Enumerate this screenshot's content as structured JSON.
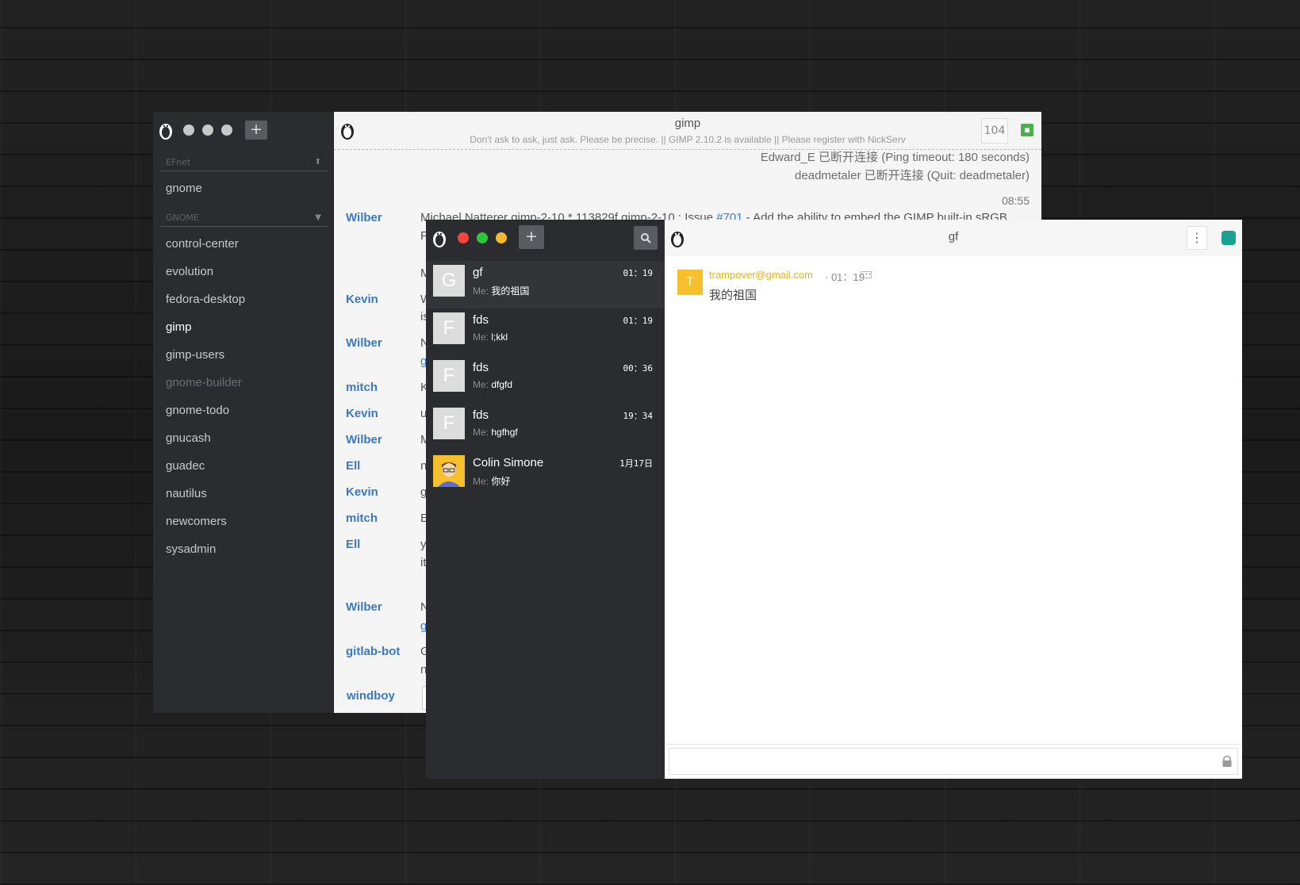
{
  "irc": {
    "networks": [
      {
        "label": "EFnet",
        "channels": [
          "gnome"
        ]
      },
      {
        "label": "GNOME",
        "channels": [
          "control-center",
          "evolution",
          "fedora-desktop",
          "gimp",
          "gimp-users",
          "gnome-builder",
          "gnome-todo",
          "gnucash",
          "guadec",
          "nautilus",
          "newcomers",
          "sysadmin"
        ]
      }
    ],
    "active_channel": "gimp",
    "add_label": "+",
    "title": "gimp",
    "topic": "Don't ask to ask, just ask. Please be precise. || GIMP 2.10.2 is available || Please register with NickServ",
    "user_count": "104",
    "system_messages": [
      "Edward_E 已断开连接 (Ping timeout: 180 seconds)",
      "deadmetaler 已断开连接 (Quit: deadmetaler)"
    ],
    "timestamp": "08:55",
    "first_message": {
      "before": "Michael Natterer gimp-2-10 * 113829f gimp-2-10 : Issue ",
      "link": "#701",
      "after": " - Add the ability to embed the GIMP built-in sRGB"
    },
    "nicks": [
      "Wilber",
      "Kevin",
      "Wilber",
      "mitch",
      "Kevin",
      "Wilber",
      "Ell",
      "Kevin",
      "mitch",
      "Ell",
      "Wilber",
      "gitlab-bot",
      "windboy"
    ],
    "line_fragments": [
      "P",
      "M",
      "W",
      "is",
      "N",
      "g",
      "K",
      "u",
      "M",
      "n",
      "g",
      "E",
      "y",
      "it",
      "N",
      "g",
      "G",
      "n"
    ]
  },
  "chat": {
    "add_label": "+",
    "conversations": [
      {
        "initial": "G",
        "name": "gf",
        "me_label": "Me:",
        "preview": "我的祖国",
        "time": "01：19"
      },
      {
        "initial": "F",
        "name": "fds",
        "me_label": "Me:",
        "preview": "l;kkl",
        "time": "01：19"
      },
      {
        "initial": "F",
        "name": "fds",
        "me_label": "Me:",
        "preview": "dfgfd",
        "time": "00：36"
      },
      {
        "initial": "F",
        "name": "fds",
        "me_label": "Me:",
        "preview": "hgfhgf",
        "time": "19：34"
      },
      {
        "initial": "",
        "name": "Colin Simone",
        "me_label": "Me:",
        "preview": "你好",
        "time": "1月17日"
      }
    ],
    "panel": {
      "title": "gf",
      "more_icon": "⋮",
      "message": {
        "avatar_initial": "T",
        "sender": "trampover@gmail.com",
        "meta": "· 01：19",
        "text": "我的祖国"
      }
    }
  },
  "colors": {
    "sidebar_bg": "#2b2c30",
    "nick_blue": "#3b78c4",
    "sender_yellow": "#e3b51f",
    "traffic_red": "#f2453d",
    "traffic_green": "#2ec53b",
    "traffic_yellow": "#f5b92f"
  }
}
